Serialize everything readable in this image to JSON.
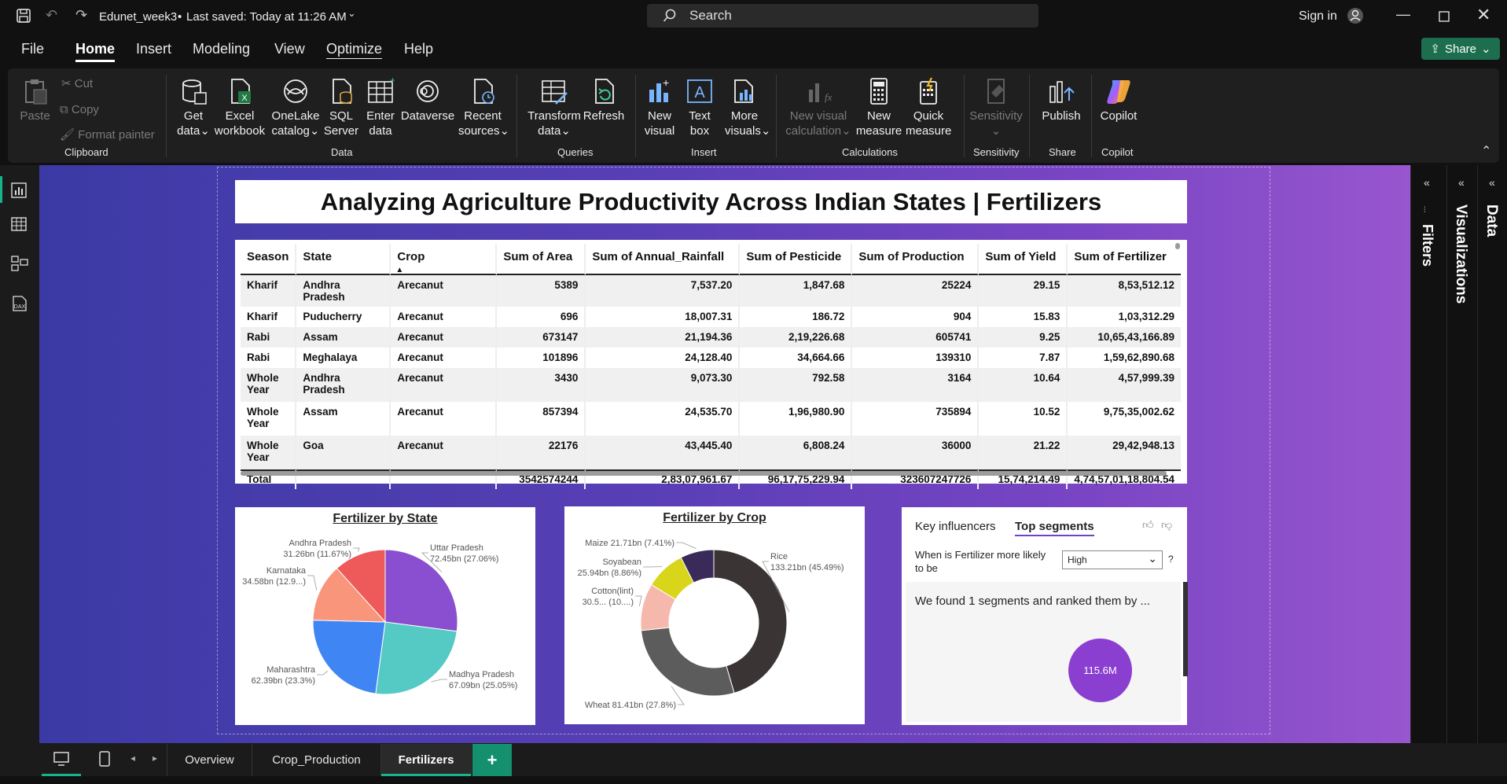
{
  "titlebar": {
    "file_name": "Edunet_week3",
    "saved_status": "Last saved: Today at 11:26 AM",
    "search_placeholder": "Search",
    "sign_in": "Sign in"
  },
  "menu": {
    "items": [
      "File",
      "Home",
      "Insert",
      "Modeling",
      "View",
      "Optimize",
      "Help"
    ],
    "active": "Home",
    "share_label": "Share"
  },
  "ribbon": {
    "clipboard": {
      "paste": "Paste",
      "cut": "Cut",
      "copy": "Copy",
      "format_painter": "Format painter",
      "label": "Clipboard"
    },
    "data": {
      "get_data": [
        "Get",
        "data"
      ],
      "excel": [
        "Excel",
        "workbook"
      ],
      "onelake": [
        "OneLake",
        "catalog"
      ],
      "sql": [
        "SQL",
        "Server"
      ],
      "enter_data": [
        "Enter",
        "data"
      ],
      "dataverse": "Dataverse",
      "recent": [
        "Recent",
        "sources"
      ],
      "label": "Data"
    },
    "queries": {
      "transform": [
        "Transform",
        "data"
      ],
      "refresh": "Refresh",
      "label": "Queries"
    },
    "insert": {
      "new_visual": [
        "New",
        "visual"
      ],
      "text_box": [
        "Text",
        "box"
      ],
      "more_visuals": [
        "More",
        "visuals"
      ],
      "label": "Insert"
    },
    "calculations": {
      "new_visual_calc": [
        "New visual",
        "calculation"
      ],
      "new_measure": [
        "New",
        "measure"
      ],
      "quick_measure": [
        "Quick",
        "measure"
      ],
      "label": "Calculations"
    },
    "sensitivity": {
      "btn": "Sensitivity",
      "label": "Sensitivity"
    },
    "share": {
      "publish": "Publish",
      "label": "Share"
    },
    "copilot": {
      "btn": "Copilot",
      "label": "Copilot"
    }
  },
  "report": {
    "title": "Analyzing Agriculture Productivity Across Indian States | Fertilizers",
    "table": {
      "headers": [
        "Season",
        "State",
        "Crop",
        "Sum of Area",
        "Sum of Annual_Rainfall",
        "Sum of Pesticide",
        "Sum of Production",
        "Sum of Yield",
        "Sum of Fertilizer"
      ],
      "rows": [
        [
          "Kharif",
          "Andhra Pradesh",
          "Arecanut",
          "5389",
          "7,537.20",
          "1,847.68",
          "25224",
          "29.15",
          "8,53,512.12"
        ],
        [
          "Kharif",
          "Puducherry",
          "Arecanut",
          "696",
          "18,007.31",
          "186.72",
          "904",
          "15.83",
          "1,03,312.29"
        ],
        [
          "Rabi",
          "Assam",
          "Arecanut",
          "673147",
          "21,194.36",
          "2,19,226.68",
          "605741",
          "9.25",
          "10,65,43,166.89"
        ],
        [
          "Rabi",
          "Meghalaya",
          "Arecanut",
          "101896",
          "24,128.40",
          "34,664.66",
          "139310",
          "7.87",
          "1,59,62,890.68"
        ],
        [
          "Whole Year",
          "Andhra Pradesh",
          "Arecanut",
          "3430",
          "9,073.30",
          "792.58",
          "3164",
          "10.64",
          "4,57,999.39"
        ],
        [
          "Whole Year",
          "Assam",
          "Arecanut",
          "857394",
          "24,535.70",
          "1,96,980.90",
          "735894",
          "10.52",
          "9,75,35,002.62"
        ],
        [
          "Whole Year",
          "Goa",
          "Arecanut",
          "22176",
          "43,445.40",
          "6,808.24",
          "36000",
          "21.22",
          "29,42,948.13"
        ]
      ],
      "total": [
        "Total",
        "",
        "",
        "3542574244",
        "2,83,07,961.67",
        "96,17,75,229.94",
        "323607247726",
        "15,74,214.49",
        "4,74,57,01,18,804.54"
      ]
    },
    "key_influencers": {
      "tab1": "Key influencers",
      "tab2": "Top segments",
      "question": "When is Fertilizer more likely to be",
      "dropdown_value": "High",
      "help": "?",
      "found_text": "We found 1 segments and ranked them by ...",
      "bubble_value": "115.6M"
    }
  },
  "chart_data": [
    {
      "type": "pie",
      "title": "Fertilizer by State",
      "slices": [
        {
          "label": "Uttar Pradesh",
          "value_label": "72.45bn (27.06%)",
          "value": 72.45,
          "color": "#8a4fd0"
        },
        {
          "label": "Madhya Pradesh",
          "value_label": "67.09bn (25.05%)",
          "value": 67.09,
          "color": "#55c9c4"
        },
        {
          "label": "Maharashtra",
          "value_label": "62.39bn (23.3%)",
          "value": 62.39,
          "color": "#3f85f3"
        },
        {
          "label": "Karnataka",
          "value_label": "34.58bn (12.9...)",
          "value": 34.58,
          "color": "#f8957a"
        },
        {
          "label": "Andhra Pradesh",
          "value_label": "31.26bn (11.67%)",
          "value": 31.26,
          "color": "#ee5a5a"
        }
      ]
    },
    {
      "type": "pie",
      "title": "Fertilizer by Crop",
      "donut": true,
      "slices": [
        {
          "label": "Rice",
          "value_label": "133.21bn (45.49%)",
          "value": 133.21,
          "color": "#3a3434"
        },
        {
          "label": "Wheat",
          "value_label": "81.41bn (27.8%)",
          "value": 81.41,
          "color": "#5c5c5c"
        },
        {
          "label": "Cotton(lint)",
          "value_label": "30.5... (10....)",
          "value": 30.5,
          "color": "#f6b7ad"
        },
        {
          "label": "Soyabean",
          "value_label": "25.94bn (8.86%)",
          "value": 25.94,
          "color": "#d8d51a"
        },
        {
          "label": "Maize",
          "value_label": "21.71bn (7.41%)",
          "value": 21.71,
          "color": "#3a2a5a"
        }
      ]
    }
  ],
  "tabs": {
    "items": [
      "Overview",
      "Crop_Production",
      "Fertilizers"
    ],
    "active": "Fertilizers",
    "add": "+"
  },
  "panes": {
    "filters": "Filters",
    "visualizations": "Visualizations",
    "data": "Data"
  }
}
